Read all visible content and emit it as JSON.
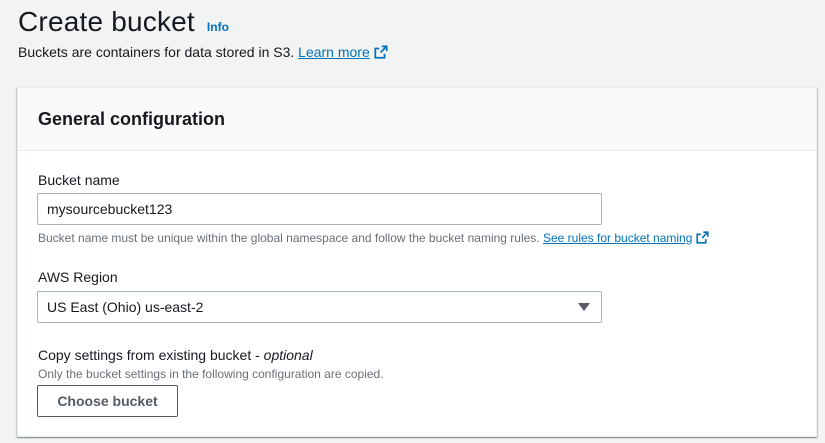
{
  "header": {
    "title": "Create bucket",
    "info_label": "Info",
    "description": "Buckets are containers for data stored in S3.",
    "learn_more_label": "Learn more"
  },
  "general_configuration": {
    "title": "General configuration",
    "bucket_name": {
      "label": "Bucket name",
      "value": "mysourcebucket123",
      "hint": "Bucket name must be unique within the global namespace and follow the bucket naming rules.",
      "rules_link_label": "See rules for bucket naming"
    },
    "aws_region": {
      "label": "AWS Region",
      "selected": "US East (Ohio) us-east-2"
    },
    "copy_settings": {
      "label": "Copy settings from existing bucket - ",
      "optional_label": "optional",
      "hint": "Only the bucket settings in the following configuration are copied.",
      "button_label": "Choose bucket"
    }
  },
  "colors": {
    "link": "#0073bb",
    "text": "#16191f",
    "secondary_text": "#687078",
    "page_background": "#f2f3f3",
    "border": "#aab7b8"
  },
  "icons": {
    "external_link": "external-link-icon",
    "dropdown": "caret-down-icon"
  }
}
